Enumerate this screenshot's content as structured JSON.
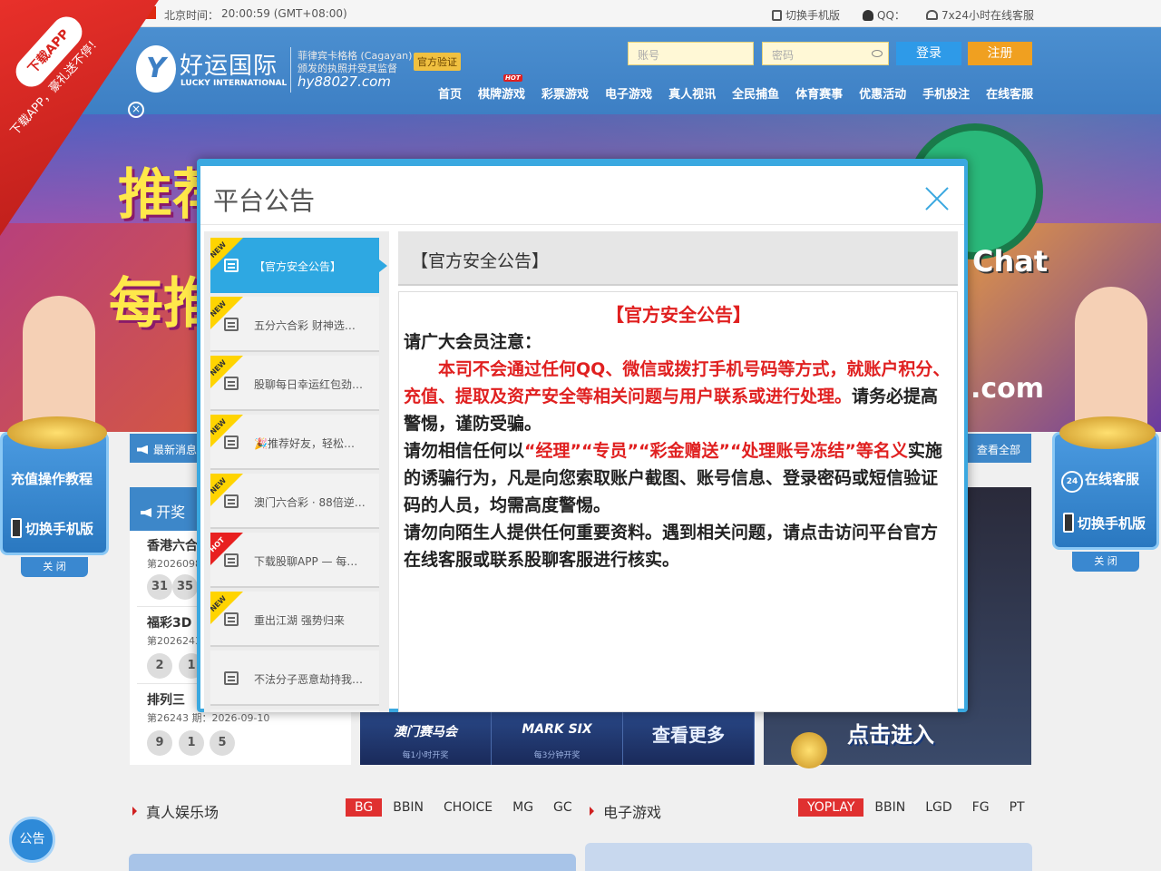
{
  "topbar": {
    "time_label": "北京时间：",
    "time_value": "20:00:59 (GMT+08:00)",
    "switch_mobile": "切换手机版",
    "qq": "QQ：",
    "service": "7x24小时在线客服"
  },
  "header": {
    "logo_name": "好运国际",
    "logo_en": "LUCKY INTERNATIONAL",
    "license_1": "菲律宾卡格格 (Cagayan)",
    "license_2": "颁发的执照并受其监督",
    "domain": "hy88027.com",
    "verified": "官方验证",
    "username_placeholder": "账号",
    "password_placeholder": "密码",
    "login": "登录",
    "register": "注册",
    "nav": [
      "首页",
      "棋牌游戏",
      "彩票游戏",
      "电子游戏",
      "真人视讯",
      "全民捕鱼",
      "体育赛事",
      "优惠活动",
      "手机投注",
      "在线客服"
    ],
    "hot_badge": "HOT"
  },
  "banner": {
    "text_1": "推荐",
    "text_2": "每推",
    "chat": "Chat",
    "domain_tail": ".com"
  },
  "notice_bar": {
    "label": "最新消息",
    "view_all": "查看全部"
  },
  "side_left": {
    "recharge": "充值操作教程",
    "mobile": "切换手机版",
    "close": "关 闭"
  },
  "side_right": {
    "service": "在线客服",
    "mobile": "切换手机版",
    "close": "关 闭"
  },
  "lottery": {
    "header": "开奖",
    "items": [
      {
        "name": "香港六合",
        "issue": "第2026098",
        "balls": [
          "31",
          "35"
        ]
      },
      {
        "name": "福彩3D",
        "issue": "第2026243",
        "balls": [
          "2",
          "1"
        ]
      },
      {
        "name": "排列三",
        "issue": "第26243 期：2026-09-10",
        "balls": [
          "9",
          "1",
          "5"
        ]
      }
    ]
  },
  "tiles": [
    {
      "title": "澳门赛马会",
      "sub": "每1小时开奖"
    },
    {
      "title": "MARK SIX",
      "sub": "每3分钟开奖"
    },
    {
      "title": "查看更多",
      "sub": ""
    }
  ],
  "enter": "点击进入",
  "live_section": {
    "title": "真人娱乐场",
    "tabs": [
      "BG",
      "BBIN",
      "CHOICE",
      "MG",
      "GC"
    ]
  },
  "slot_section": {
    "title": "电子游戏",
    "tabs": [
      "YOPLAY",
      "BBIN",
      "LGD",
      "FG",
      "PT"
    ]
  },
  "notice_button": "公告",
  "app_ribbon": {
    "pill": "下载APP",
    "slogan": "下载APP，豪礼送不停！"
  },
  "modal": {
    "title": "平台公告",
    "items": [
      {
        "tag": "NEW",
        "label": "【官方安全公告】"
      },
      {
        "tag": "NEW",
        "label": "五分六合彩 财神选…"
      },
      {
        "tag": "NEW",
        "label": "股聊每日幸运红包劲…"
      },
      {
        "tag": "NEW",
        "label": "🎉推荐好友，轻松…"
      },
      {
        "tag": "NEW",
        "label": "澳门六合彩 · 88倍逆…"
      },
      {
        "tag": "HOT",
        "label": "下载股聊APP — 每…"
      },
      {
        "tag": "NEW",
        "label": "重出江湖 强势归来"
      },
      {
        "tag": "",
        "label": "不法分子恶意劫持我…"
      }
    ],
    "content_head": "【官方安全公告】",
    "content": {
      "title": "【官方安全公告】",
      "p1": "请广大会员注意：",
      "p2_red": "本司不会通过任何QQ、微信或拨打手机号码等方式，就账户积分、充值、提取及资产安全等相关问题与用户联系或进行处理。",
      "p2_tail": "请务必提高警惕，谨防受骗。",
      "p3_head": "请勿相信任何以",
      "p3_red": "“经理”“专员”“彩金赠送”“处理账号冻结”等名义",
      "p3_tail": "实施的诱骗行为，凡是向您索取账户截图、账号信息、登录密码或短信验证码的人员，均需高度警惕。",
      "p4": "请勿向陌生人提供任何重要资料。遇到相关问题，请点击访问平台官方在线客服或联系股聊客服进行核实。"
    }
  }
}
